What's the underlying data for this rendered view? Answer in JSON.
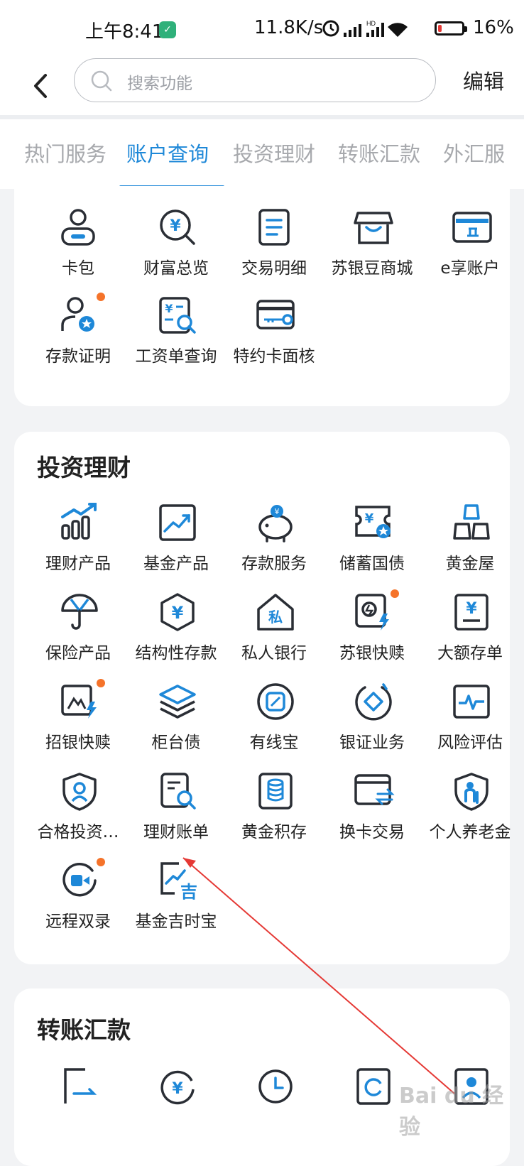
{
  "status_bar": {
    "time": "上午8:41",
    "net_speed": "11.8K/s",
    "battery": "16%",
    "battery_level": 0.16
  },
  "header": {
    "back_icon": "chevron-left-icon",
    "search_placeholder": "搜索功能",
    "edit_label": "编辑"
  },
  "tabs": [
    {
      "label": "热门服务",
      "active": false
    },
    {
      "label": "账户查询",
      "active": true
    },
    {
      "label": "投资理财",
      "active": false
    },
    {
      "label": "转账汇款",
      "active": false
    },
    {
      "label": "外汇服",
      "active": false
    }
  ],
  "account_section": {
    "items": [
      {
        "label": "卡包",
        "icon": "user-card-icon"
      },
      {
        "label": "财富总览",
        "icon": "yuan-search-icon"
      },
      {
        "label": "交易明细",
        "icon": "receipt-icon"
      },
      {
        "label": "苏银豆商城",
        "icon": "shop-icon"
      },
      {
        "label": "e享账户",
        "icon": "bank-card-icon"
      },
      {
        "label": "存款证明",
        "icon": "certificate-user-icon",
        "badge": true
      },
      {
        "label": "工资单查询",
        "icon": "payslip-search-icon"
      },
      {
        "label": "特约卡面核",
        "icon": "card-key-icon"
      }
    ]
  },
  "invest_section": {
    "title": "投资理财",
    "items": [
      {
        "label": "理财产品",
        "icon": "bar-chart-icon"
      },
      {
        "label": "基金产品",
        "icon": "trend-chart-icon"
      },
      {
        "label": "存款服务",
        "icon": "piggy-bank-icon"
      },
      {
        "label": "储蓄国债",
        "icon": "bond-ticket-icon"
      },
      {
        "label": "黄金屋",
        "icon": "gold-bars-icon"
      },
      {
        "label": "保险产品",
        "icon": "umbrella-icon"
      },
      {
        "label": "结构性存款",
        "icon": "hexagon-yuan-icon"
      },
      {
        "label": "私人银行",
        "icon": "private-house-icon"
      },
      {
        "label": "苏银快赎",
        "icon": "quick-redeem-icon",
        "badge": true
      },
      {
        "label": "大额存单",
        "icon": "deposit-slip-icon"
      },
      {
        "label": "招银快赎",
        "icon": "picture-bolt-icon",
        "badge": true
      },
      {
        "label": "柜台债",
        "icon": "layers-icon"
      },
      {
        "label": "有线宝",
        "icon": "circle-square-icon"
      },
      {
        "label": "银证业务",
        "icon": "ring-diamond-icon"
      },
      {
        "label": "风险评估",
        "icon": "pulse-monitor-icon"
      },
      {
        "label": "合格投资…",
        "icon": "shield-user-icon"
      },
      {
        "label": "理财账单",
        "icon": "document-search-icon"
      },
      {
        "label": "黄金积存",
        "icon": "database-icon"
      },
      {
        "label": "换卡交易",
        "icon": "card-swap-icon"
      },
      {
        "label": "个人养老金",
        "icon": "shield-elder-icon"
      },
      {
        "label": "远程双录",
        "icon": "video-record-icon",
        "badge": true
      },
      {
        "label": "基金吉时宝",
        "icon": "fund-ji-icon"
      }
    ]
  },
  "transfer_section": {
    "title": "转账汇款",
    "items": [
      {
        "icon": "transfer-doc-icon"
      },
      {
        "icon": "yuan-refresh-icon"
      },
      {
        "icon": "clock-icon"
      },
      {
        "icon": "refresh-doc-icon"
      },
      {
        "icon": "user-doc-icon"
      }
    ]
  },
  "watermark": "Bai du 经验"
}
